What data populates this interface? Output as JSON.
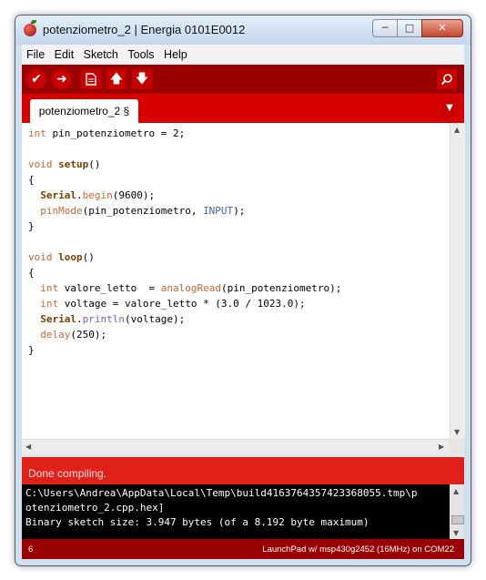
{
  "window": {
    "title": "potenziometro_2 | Energia 0101E0012",
    "controls": [
      "minimize",
      "maximize",
      "close"
    ]
  },
  "menu": [
    "File",
    "Edit",
    "Sketch",
    "Tools",
    "Help"
  ],
  "toolbar": {
    "buttons": [
      {
        "name": "verify",
        "icon": "check-icon"
      },
      {
        "name": "upload",
        "icon": "arrow-right-icon"
      },
      {
        "name": "new",
        "icon": "document-icon"
      },
      {
        "name": "open",
        "icon": "arrow-up-icon"
      },
      {
        "name": "save",
        "icon": "arrow-down-icon"
      },
      {
        "name": "serial-monitor",
        "icon": "magnifier-icon"
      }
    ]
  },
  "tabs": [
    {
      "label": "potenziometro_2 §",
      "active": true
    }
  ],
  "editor": {
    "lines": [
      "int pin_potenziometro = 2;",
      "",
      "void setup()",
      "{",
      "  Serial.begin(9600);",
      "  pinMode(pin_potenziometro, INPUT);",
      "}",
      "",
      "void loop()",
      "{",
      "  int valore_letto  = analogRead(pin_potenziometro);",
      "  int voltage = valore_letto * (3.0 / 1023.0);",
      "  Serial.println(voltage);",
      "  delay(250);",
      "}"
    ]
  },
  "status": {
    "message": "Done compiling."
  },
  "console": {
    "lines": [
      "C:\\Users\\Andrea\\AppData\\Local\\Temp\\build4163764357423368055.tmp\\p",
      "otenziometro_2.cpp.hex]",
      "Binary sketch size: 3.947 bytes (of a 8.192 byte maximum)"
    ]
  },
  "footer": {
    "line_number": "6",
    "board": "LaunchPad w/ msp430g2452 (16MHz) on COM22"
  },
  "colors": {
    "toolbar_bg": "#9b0000",
    "tabbar_bg": "#d90000",
    "status_bg": "#e0211a",
    "console_bg": "#000000",
    "keyword_orange": "#cc6633",
    "type_purple": "#7b5ec5",
    "constant_blue": "#3b66b8"
  }
}
